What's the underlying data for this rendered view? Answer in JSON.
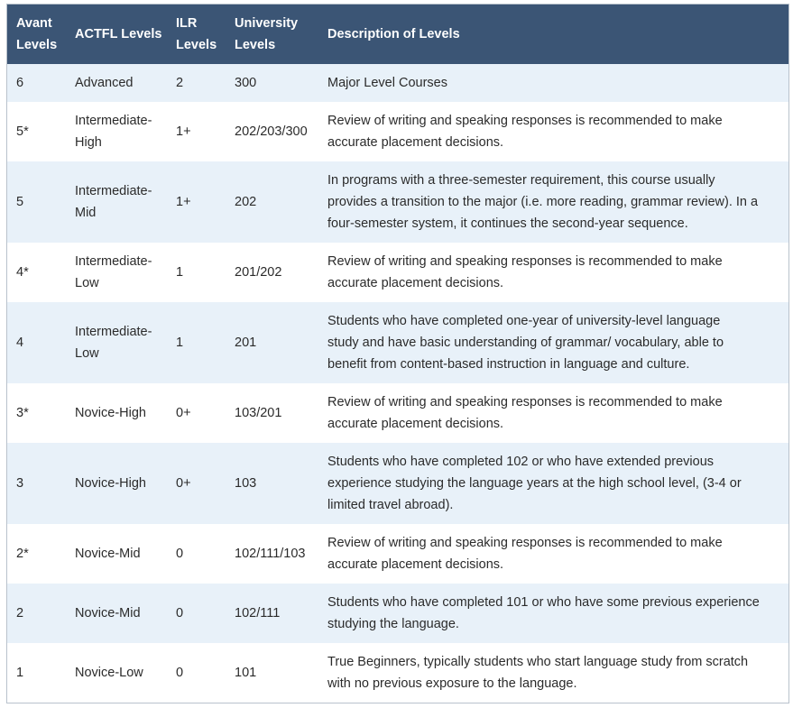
{
  "table": {
    "headers": [
      [
        "Avant",
        "Levels"
      ],
      [
        "ACTFL Levels"
      ],
      [
        "ILR",
        "Levels"
      ],
      [
        "University",
        "Levels"
      ],
      [
        "Description of Levels"
      ]
    ],
    "rows": [
      {
        "avant": "6",
        "actfl": [
          "Advanced"
        ],
        "ilr": "2",
        "university": "300",
        "description": [
          "Major Level Courses"
        ]
      },
      {
        "avant": "5*",
        "actfl": [
          "Intermediate-",
          "High"
        ],
        "ilr": "1+",
        "university": "202/203/300",
        "description": [
          "Review of writing and speaking responses is recommended to make",
          "accurate placement decisions."
        ]
      },
      {
        "avant": "5",
        "actfl": [
          "Intermediate-",
          "Mid"
        ],
        "ilr": "1+",
        "university": "202",
        "description": [
          "In programs with a three-semester requirement, this course usually",
          "provides a transition to the major (i.e. more reading, grammar review). In a",
          "four-semester system, it continues the second-year sequence."
        ]
      },
      {
        "avant": "4*",
        "actfl": [
          "Intermediate-",
          "Low"
        ],
        "ilr": "1",
        "university": "201/202",
        "description": [
          "Review of writing and speaking responses is recommended to make",
          "accurate placement decisions."
        ]
      },
      {
        "avant": "4",
        "actfl": [
          "Intermediate-",
          "Low"
        ],
        "ilr": "1",
        "university": "201",
        "description": [
          "Students who have completed one-year of university-level language",
          "study and have basic understanding of grammar/ vocabulary, able to",
          "benefit from content-based instruction in language and culture."
        ]
      },
      {
        "avant": "3*",
        "actfl": [
          "Novice-High"
        ],
        "ilr": "0+",
        "university": "103/201",
        "description": [
          "Review of writing and speaking responses is recommended to make",
          "accurate placement decisions."
        ]
      },
      {
        "avant": "3",
        "actfl": [
          "Novice-High"
        ],
        "ilr": "0+",
        "university": "103",
        "description": [
          "Students who have completed 102 or who have extended previous",
          "experience studying the language years at the high school level, (3-4 or",
          "limited travel abroad)."
        ]
      },
      {
        "avant": "2*",
        "actfl": [
          "Novice-Mid"
        ],
        "ilr": "0",
        "university": "102/111/103",
        "description": [
          "Review of writing and speaking responses is recommended to make",
          "accurate placement decisions."
        ]
      },
      {
        "avant": "2",
        "actfl": [
          "Novice-Mid"
        ],
        "ilr": "0",
        "university": "102/111",
        "description": [
          "Students who have completed 101 or who have some previous experience",
          "studying the language."
        ]
      },
      {
        "avant": "1",
        "actfl": [
          "Novice-Low"
        ],
        "ilr": "0",
        "university": "101",
        "description": [
          "True Beginners, typically students who start language study from scratch",
          "with no previous exposure to the language."
        ]
      }
    ]
  },
  "colors": {
    "header_bg": "#3b5575",
    "stripe_bg": "#e8f1f9",
    "border": "#b9c2cc"
  }
}
